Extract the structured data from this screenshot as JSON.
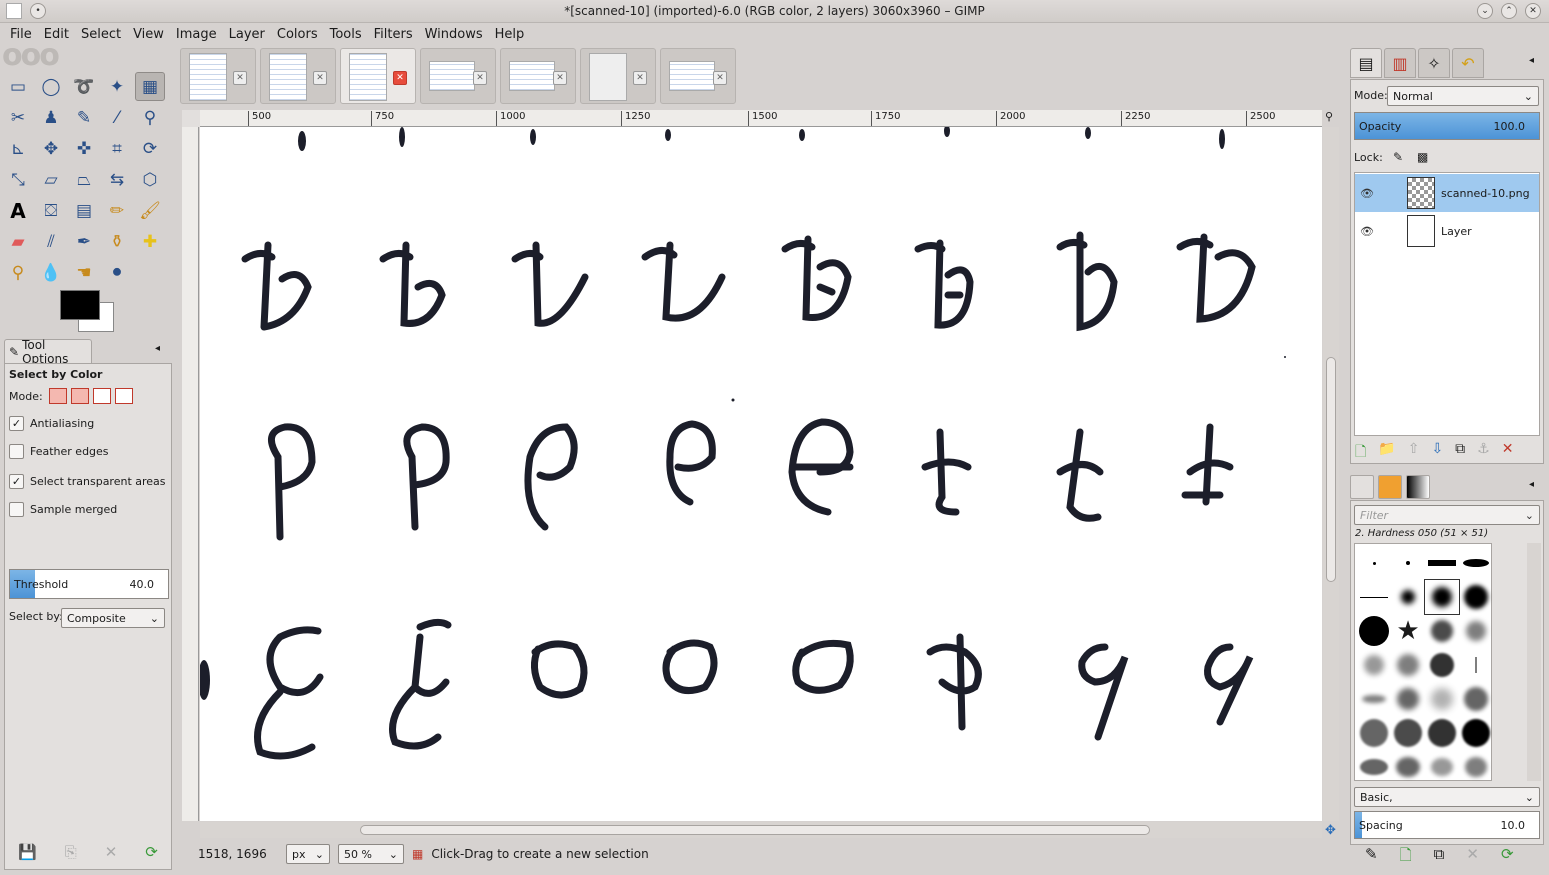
{
  "window": {
    "title": "*[scanned-10] (imported)-6.0 (RGB color, 2 layers) 3060x3960 – GIMP"
  },
  "menu": [
    "File",
    "Edit",
    "Select",
    "View",
    "Image",
    "Layer",
    "Colors",
    "Tools",
    "Filters",
    "Windows",
    "Help"
  ],
  "toolbox": {
    "tools": [
      "rect-select",
      "ellipse-select",
      "free-select",
      "fuzzy-select",
      "select-by-color",
      "scissors",
      "foreground-select",
      "paths",
      "color-picker",
      "zoom",
      "measure",
      "move",
      "align",
      "crop",
      "rotate",
      "scale",
      "shear",
      "perspective",
      "flip",
      "cage",
      "text",
      "bucket-fill",
      "blend",
      "pencil",
      "paintbrush",
      "eraser",
      "airbrush",
      "ink",
      "clone",
      "heal",
      "perspective-clone",
      "blur",
      "smudge",
      "dodge-burn"
    ],
    "active_tool_index": 4,
    "fg_color": "#000000",
    "bg_color": "#ffffff"
  },
  "tool_options": {
    "tab_label": "Tool Options",
    "heading": "Select by Color",
    "mode_label": "Mode:",
    "antialiasing": {
      "label": "Antialiasing",
      "checked": true
    },
    "feather": {
      "label": "Feather edges",
      "checked": false
    },
    "transparent": {
      "label": "Select transparent areas",
      "checked": true
    },
    "sample_merged": {
      "label": "Sample merged",
      "checked": false
    },
    "threshold": {
      "label": "Threshold",
      "value": "40.0",
      "fraction": 0.157
    },
    "select_by": {
      "label": "Select by:",
      "value": "Composite"
    }
  },
  "image_tabs": [
    {
      "name": "tab-1",
      "active": false
    },
    {
      "name": "tab-2",
      "active": false
    },
    {
      "name": "tab-3",
      "active": true
    },
    {
      "name": "tab-4",
      "active": false
    },
    {
      "name": "tab-5",
      "active": false
    },
    {
      "name": "tab-6",
      "active": false
    },
    {
      "name": "tab-7",
      "active": false
    }
  ],
  "ruler": {
    "labels": [
      "500",
      "750",
      "1000",
      "1250",
      "1500",
      "1750",
      "2000",
      "2250",
      "2500"
    ]
  },
  "status": {
    "coords": "1518, 1696",
    "unit": "px",
    "zoom": "50 %",
    "message": "Click-Drag to create a new selection"
  },
  "layers": {
    "mode_label": "Mode:",
    "mode_value": "Normal",
    "opacity_label": "Opacity",
    "opacity_value": "100.0",
    "lock_label": "Lock:",
    "items": [
      {
        "name": "scanned-10.png",
        "selected": true
      },
      {
        "name": "Layer",
        "selected": false
      }
    ]
  },
  "brushes": {
    "filter_placeholder": "Filter",
    "current": "2. Hardness 050 (51 × 51)",
    "preset": "Basic,",
    "spacing_label": "Spacing",
    "spacing_value": "10.0"
  }
}
